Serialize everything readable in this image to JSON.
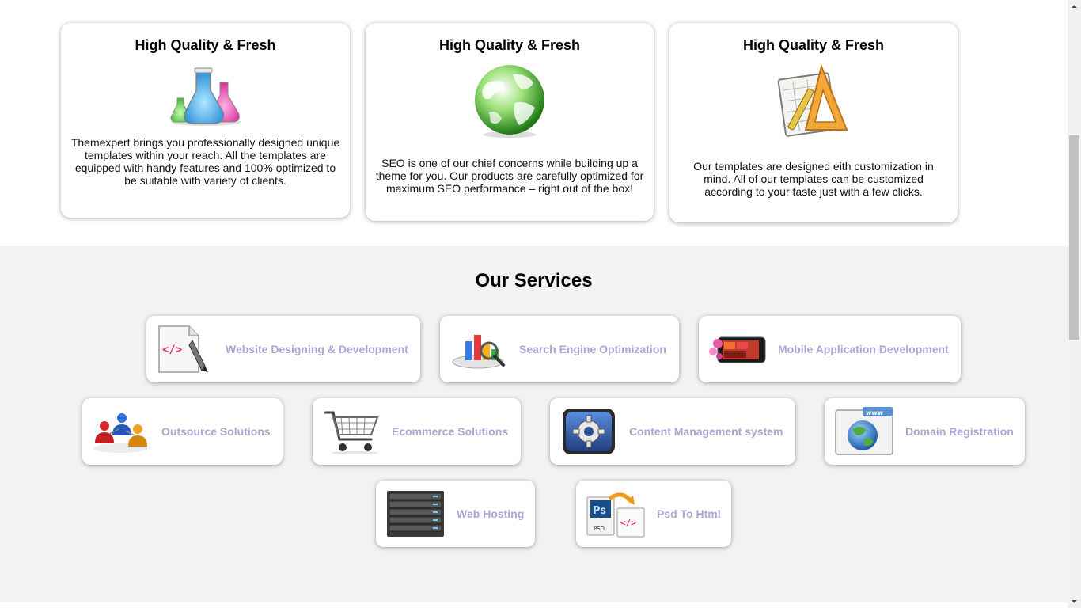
{
  "features": [
    {
      "title": "High Quality & Fresh",
      "icon": "flasks-icon",
      "text": "Themexpert brings you professionally designed unique templates within your reach. All the templates are equipped with handy features and 100% optimized to be suitable with variety of clients."
    },
    {
      "title": "High Quality & Fresh",
      "icon": "globe-icon",
      "text": "SEO is one of our chief concerns while building up a theme for you. Our products are carefully optimized for maximum SEO performance – right out of the box!"
    },
    {
      "title": "High Quality & Fresh",
      "icon": "design-tools-icon",
      "text": "Our templates are designed eith customization in mind. All of our templates can be customized according to your taste just with a few clicks."
    }
  ],
  "services": {
    "heading": "Our Services",
    "items": [
      {
        "label": "Website Designing & Development",
        "icon": "code-document-icon"
      },
      {
        "label": "Search Engine Optimization",
        "icon": "seo-chart-magnifier-icon"
      },
      {
        "label": "Mobile Application Development",
        "icon": "mobile-device-icon"
      },
      {
        "label": "Outsource Solutions",
        "icon": "people-network-icon"
      },
      {
        "label": "Ecommerce Solutions",
        "icon": "shopping-cart-icon"
      },
      {
        "label": "Content Management system",
        "icon": "gear-icon"
      },
      {
        "label": "Domain Registration",
        "icon": "www-globe-icon"
      },
      {
        "label": "Web Hosting",
        "icon": "server-rack-icon"
      },
      {
        "label": "Psd To Html",
        "icon": "psd-to-html-icon"
      }
    ]
  },
  "colors": {
    "service_label": "#a7a7d3",
    "services_background": "#f2f2f2",
    "card_background": "#ffffff"
  }
}
